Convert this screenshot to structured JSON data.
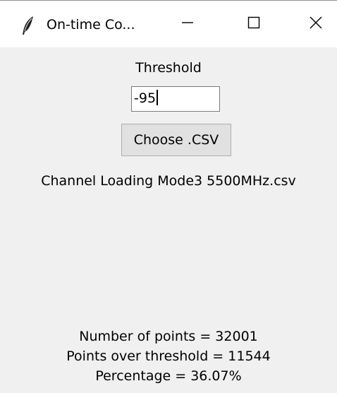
{
  "window": {
    "title": "On-time Co...",
    "icons": {
      "app": "feather-icon",
      "minimize": "minimize-icon",
      "maximize": "maximize-icon",
      "close": "close-icon"
    }
  },
  "form": {
    "threshold_label": "Threshold",
    "threshold_value": "-95",
    "choose_button_label": "Choose .CSV",
    "file_name": "Channel Loading Mode3 5500MHz.csv"
  },
  "stats": {
    "points": "Number of points = 32001",
    "over_threshold": "Points over threshold = 11544",
    "percentage": "Percentage = 36.07%"
  },
  "colors": {
    "titlebar_bg": "#ffffff",
    "window_bg": "#f0f0f0",
    "button_bg": "#e1e1e1",
    "button_border": "#adadad",
    "entry_border": "#7a7a7a"
  }
}
